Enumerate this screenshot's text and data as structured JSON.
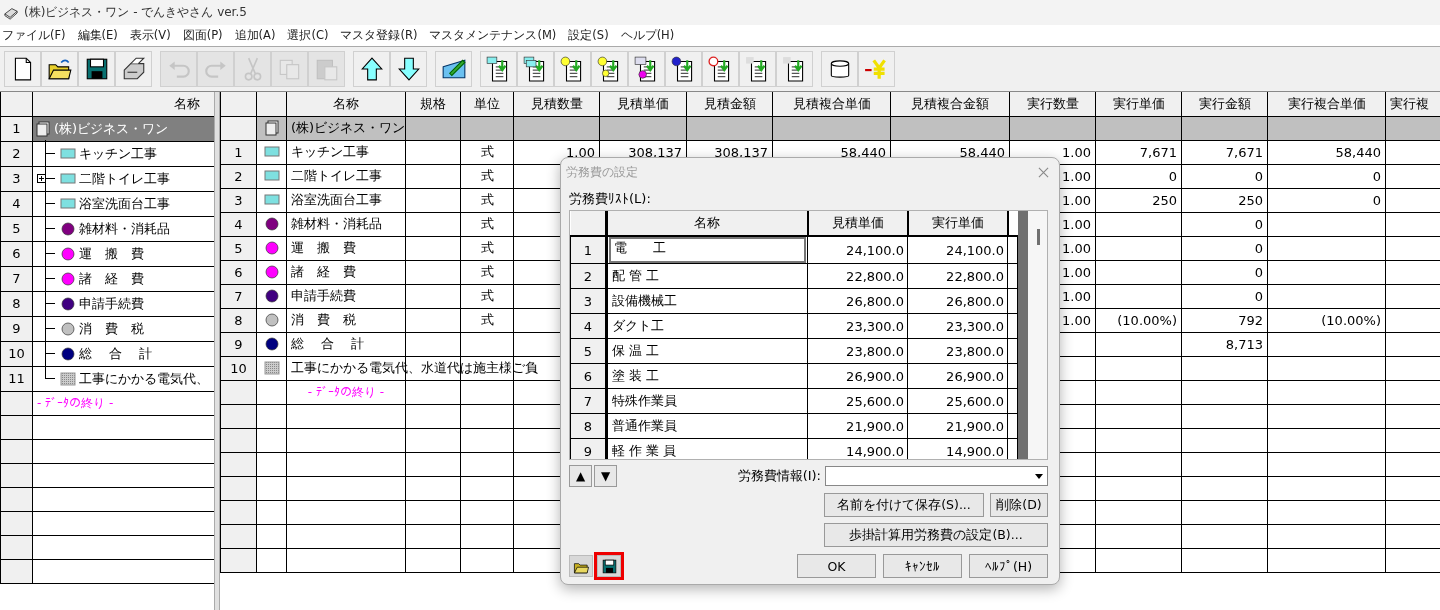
{
  "window": {
    "title": "(株)ビジネス・ワン - でんきやさん ver.5"
  },
  "menu": [
    "ファイル(F)",
    "編集(E)",
    "表示(V)",
    "図面(P)",
    "追加(A)",
    "選択(C)",
    "マスタ登録(R)",
    "マスタメンテナンス(M)",
    "設定(S)",
    "ヘルプ(H)"
  ],
  "toolbar": [
    [
      {
        "kind": "new",
        "disabled": false
      },
      {
        "kind": "open",
        "disabled": false
      },
      {
        "kind": "save",
        "disabled": false
      },
      {
        "kind": "print",
        "disabled": false
      }
    ],
    [
      {
        "kind": "undo",
        "disabled": true
      },
      {
        "kind": "redo",
        "disabled": true
      },
      {
        "kind": "cut",
        "disabled": true
      },
      {
        "kind": "copy",
        "disabled": true
      },
      {
        "kind": "paste",
        "disabled": true
      }
    ],
    [
      {
        "kind": "up",
        "disabled": false
      },
      {
        "kind": "down",
        "disabled": false
      }
    ],
    [
      {
        "kind": "edit",
        "disabled": false
      }
    ],
    [
      {
        "kind": "doc-block",
        "disabled": false
      },
      {
        "kind": "doc-blocks",
        "disabled": false
      },
      {
        "kind": "doc-ball",
        "disabled": false
      },
      {
        "kind": "doc-balls",
        "disabled": false
      },
      {
        "kind": "doc-list",
        "disabled": false
      },
      {
        "kind": "doc-blue-ball",
        "disabled": false
      },
      {
        "kind": "doc-note",
        "disabled": false
      },
      {
        "kind": "doc-blank",
        "disabled": false
      },
      {
        "kind": "doc-blank",
        "disabled": false
      }
    ],
    [
      {
        "kind": "database",
        "disabled": false
      },
      {
        "kind": "yen",
        "disabled": false
      }
    ]
  ],
  "tree": {
    "header": "名称",
    "end_marker": "- ﾃﾞｰﾀの終り -",
    "root": {
      "no": "1",
      "name": "(株)ビジネス・ワン",
      "kind": "document",
      "selected": true,
      "collapsed": false,
      "children": [
        {
          "no": "2",
          "name": "キッチン工事",
          "kind": "block",
          "selected": false,
          "collapsed": false
        },
        {
          "no": "3",
          "name": "二階トイレ工事",
          "kind": "block",
          "selected": false,
          "collapsed": true
        },
        {
          "no": "4",
          "name": "浴室洗面台工事",
          "kind": "block",
          "selected": false,
          "collapsed": false
        },
        {
          "no": "5",
          "name": "雑材料・消耗品",
          "kind": "ball",
          "color": "#800080",
          "selected": false,
          "collapsed": false
        },
        {
          "no": "6",
          "name": "運　搬　費",
          "kind": "ball",
          "color": "#ff00ff",
          "selected": false,
          "collapsed": false
        },
        {
          "no": "7",
          "name": "諸　経　費",
          "kind": "ball",
          "color": "#ff00ff",
          "selected": false,
          "collapsed": false
        },
        {
          "no": "8",
          "name": "申請手続費",
          "kind": "ball",
          "color": "#400080",
          "selected": false,
          "collapsed": false
        },
        {
          "no": "9",
          "name": "消　費　税",
          "kind": "ball",
          "color": "#c0c0c0",
          "selected": false,
          "collapsed": false
        },
        {
          "no": "10",
          "name": "総　 合　 計",
          "kind": "ball",
          "color": "#000080",
          "selected": false,
          "collapsed": false
        },
        {
          "no": "11",
          "name": "工事にかかる電気代、",
          "kind": "note",
          "selected": false,
          "collapsed": false
        }
      ]
    }
  },
  "table": {
    "end_marker": "- ﾃﾞｰﾀの終り -",
    "columns": [
      "名称",
      "規格",
      "単位",
      "見積数量",
      "見積単価",
      "見積金額",
      "見積複合単価",
      "見積複合金額",
      "実行数量",
      "実行単価",
      "実行金額",
      "実行複合単価",
      "実行複"
    ],
    "rows": [
      {
        "kind": "document",
        "name": "(株)ビジネス・ワン"
      },
      {
        "kind": "block",
        "no": "1",
        "name": "キッチン工事",
        "unit": "式",
        "est_qty": "1.00",
        "est_price": "308,137",
        "est_amount": "308,137",
        "est_comp_price": "58,440",
        "est_comp_amount": "58,440",
        "act_qty": "1.00",
        "act_price": "7,671",
        "act_amount": "7,671",
        "act_comp_price": "58,440"
      },
      {
        "kind": "block",
        "no": "2",
        "name": "二階トイレ工事",
        "unit": "式",
        "act_qty": "1.00",
        "act_price": "0",
        "act_amount": "0",
        "act_comp_price": "0"
      },
      {
        "kind": "block",
        "no": "3",
        "name": "浴室洗面台工事",
        "unit": "式",
        "act_qty": "1.00",
        "act_price": "250",
        "act_amount": "250",
        "act_comp_price": "0"
      },
      {
        "kind": "ball",
        "color": "#800080",
        "no": "4",
        "name": "雑材料・消耗品",
        "unit": "式",
        "act_qty": "1.00",
        "act_amount": "0"
      },
      {
        "kind": "ball",
        "color": "#ff00ff",
        "no": "5",
        "name": "運　搬　費",
        "unit": "式",
        "act_qty": "1.00",
        "act_amount": "0"
      },
      {
        "kind": "ball",
        "color": "#ff00ff",
        "no": "6",
        "name": "諸　経　費",
        "unit": "式",
        "act_qty": "1.00",
        "act_amount": "0"
      },
      {
        "kind": "ball",
        "color": "#400080",
        "no": "7",
        "name": "申請手続費",
        "unit": "式",
        "act_qty": "1.00",
        "act_amount": "0"
      },
      {
        "kind": "ball",
        "color": "#c0c0c0",
        "no": "8",
        "name": "消　費　税",
        "unit": "式",
        "act_qty": "1.00",
        "act_price": "(10.00%)",
        "act_amount": "792",
        "act_comp_price": "(10.00%)"
      },
      {
        "kind": "ball",
        "color": "#000080",
        "no": "9",
        "name": "総　 合　 計",
        "act_amount": "8,713"
      },
      {
        "kind": "note",
        "no": "10",
        "name": "工事にかかる電気代、水道代は施主様ご負"
      }
    ]
  },
  "dialog": {
    "title": "労務費の設定",
    "list_label": "労務費ﾘｽﾄ(L):",
    "columns": [
      "名称",
      "見積単価",
      "実行単価"
    ],
    "rows": [
      {
        "no": "1",
        "name": "電　　工",
        "est": "24,100.0",
        "act": "24,100.0",
        "focused": true
      },
      {
        "no": "2",
        "name": "配 管 工",
        "est": "22,800.0",
        "act": "22,800.0",
        "focused": false
      },
      {
        "no": "3",
        "name": "設備機械工",
        "est": "26,800.0",
        "act": "26,800.0",
        "focused": false
      },
      {
        "no": "4",
        "name": "ダクト工",
        "est": "23,300.0",
        "act": "23,300.0",
        "focused": false
      },
      {
        "no": "5",
        "name": "保 温 工",
        "est": "23,800.0",
        "act": "23,800.0",
        "focused": false
      },
      {
        "no": "6",
        "name": "塗 装 工",
        "est": "26,900.0",
        "act": "26,900.0",
        "focused": false
      },
      {
        "no": "7",
        "name": "特殊作業員",
        "est": "25,600.0",
        "act": "25,600.0",
        "focused": false
      },
      {
        "no": "8",
        "name": "普通作業員",
        "est": "21,900.0",
        "act": "21,900.0",
        "focused": false
      },
      {
        "no": "9",
        "name": "軽 作 業 員",
        "est": "14,900.0",
        "act": "14,900.0",
        "focused": false
      }
    ],
    "move_up": "▲",
    "move_down": "▼",
    "info_label": "労務費情報(I):",
    "save_as": "名前を付けて保存(S)...",
    "delete": "削除(D)",
    "ladder": "歩掛計算用労務費の設定(B)...",
    "icon_buttons": [
      {
        "kind": "open",
        "highlighted": false
      },
      {
        "kind": "save",
        "highlighted": true
      }
    ],
    "ok": "OK",
    "cancel": "ｷｬﾝｾﾙ",
    "help": "ﾍﾙﾌﾟ(H)"
  }
}
